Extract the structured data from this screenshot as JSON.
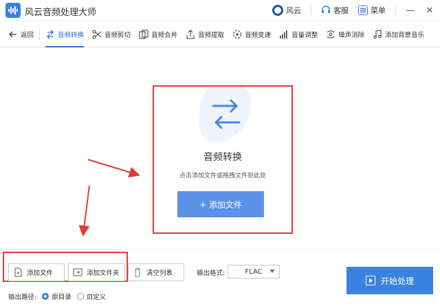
{
  "app": {
    "title": "风云音频处理大师"
  },
  "titlebar": {
    "brand_label": "风云",
    "service_label": "客服",
    "menu_label": "菜单",
    "minimize_glyph": "—",
    "close_glyph": "✕"
  },
  "toolbar": {
    "back_label": "返回",
    "tools": [
      {
        "label": "音频转换",
        "icon": "convert-icon",
        "active": true
      },
      {
        "label": "音频剪切",
        "icon": "scissors-icon",
        "active": false
      },
      {
        "label": "音频合并",
        "icon": "merge-icon",
        "active": false
      },
      {
        "label": "音频提取",
        "icon": "extract-icon",
        "active": false
      },
      {
        "label": "音频变速",
        "icon": "speed-icon",
        "active": false
      },
      {
        "label": "音量调整",
        "icon": "volume-bars-icon",
        "active": false
      },
      {
        "label": "噪声消除",
        "icon": "noise-icon",
        "active": false
      },
      {
        "label": "添加背景音乐",
        "icon": "music-note-icon",
        "active": false
      }
    ]
  },
  "drop": {
    "title": "音频转换",
    "subtitle": "点击添加文件或拖拽文件到此处",
    "add_button": "+ 添加文件"
  },
  "bottom": {
    "add_file": "添加文件",
    "add_folder": "添加文件夹",
    "clear_list": "清空列表",
    "format_label": "输出格式:",
    "format_value": "FLAC",
    "start_button": "开始处理",
    "output_path_label": "输出路径:",
    "option_original": "原目录",
    "option_custom": "自定义"
  },
  "colors": {
    "accent": "#3b82e0",
    "highlight_red": "#e53935",
    "drop_button": "#5b93e8"
  }
}
